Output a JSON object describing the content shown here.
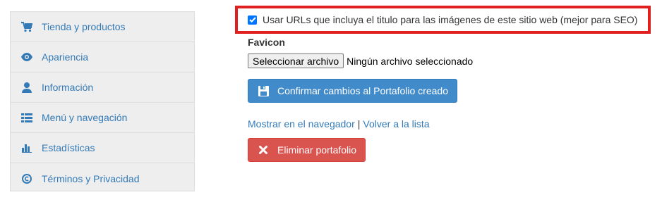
{
  "sidebar": {
    "items": [
      {
        "label": "Tienda y productos",
        "icon": "cart-icon"
      },
      {
        "label": "Apariencia",
        "icon": "eye-icon"
      },
      {
        "label": "Información",
        "icon": "user-icon"
      },
      {
        "label": "Menú y navegación",
        "icon": "list-icon"
      },
      {
        "label": "Estadísticas",
        "icon": "bar-chart-icon"
      },
      {
        "label": "Términos y Privacidad",
        "icon": "copyright-icon"
      }
    ]
  },
  "seo_option": {
    "label": "Usar URLs que incluya el titulo para las imágenes de este sitio web (mejor para SEO)",
    "checked": true
  },
  "favicon": {
    "title": "Favicon",
    "choose_button": "Seleccionar archivo",
    "status": "Ningún archivo seleccionado"
  },
  "confirm_button": {
    "label": "Confirmar cambios al Portafolio creado",
    "icon": "save-icon"
  },
  "links": {
    "show_in_browser": "Mostrar en el navegador",
    "separator": "|",
    "back_to_list": "Volver a la lista"
  },
  "delete_button": {
    "label": "Eliminar portafolio",
    "icon": "close-icon"
  },
  "colors": {
    "link": "#337ab7",
    "primary": "#428bca",
    "danger": "#d9534f",
    "highlight_border": "#e0201f",
    "sidebar_bg": "#eeeeee"
  }
}
